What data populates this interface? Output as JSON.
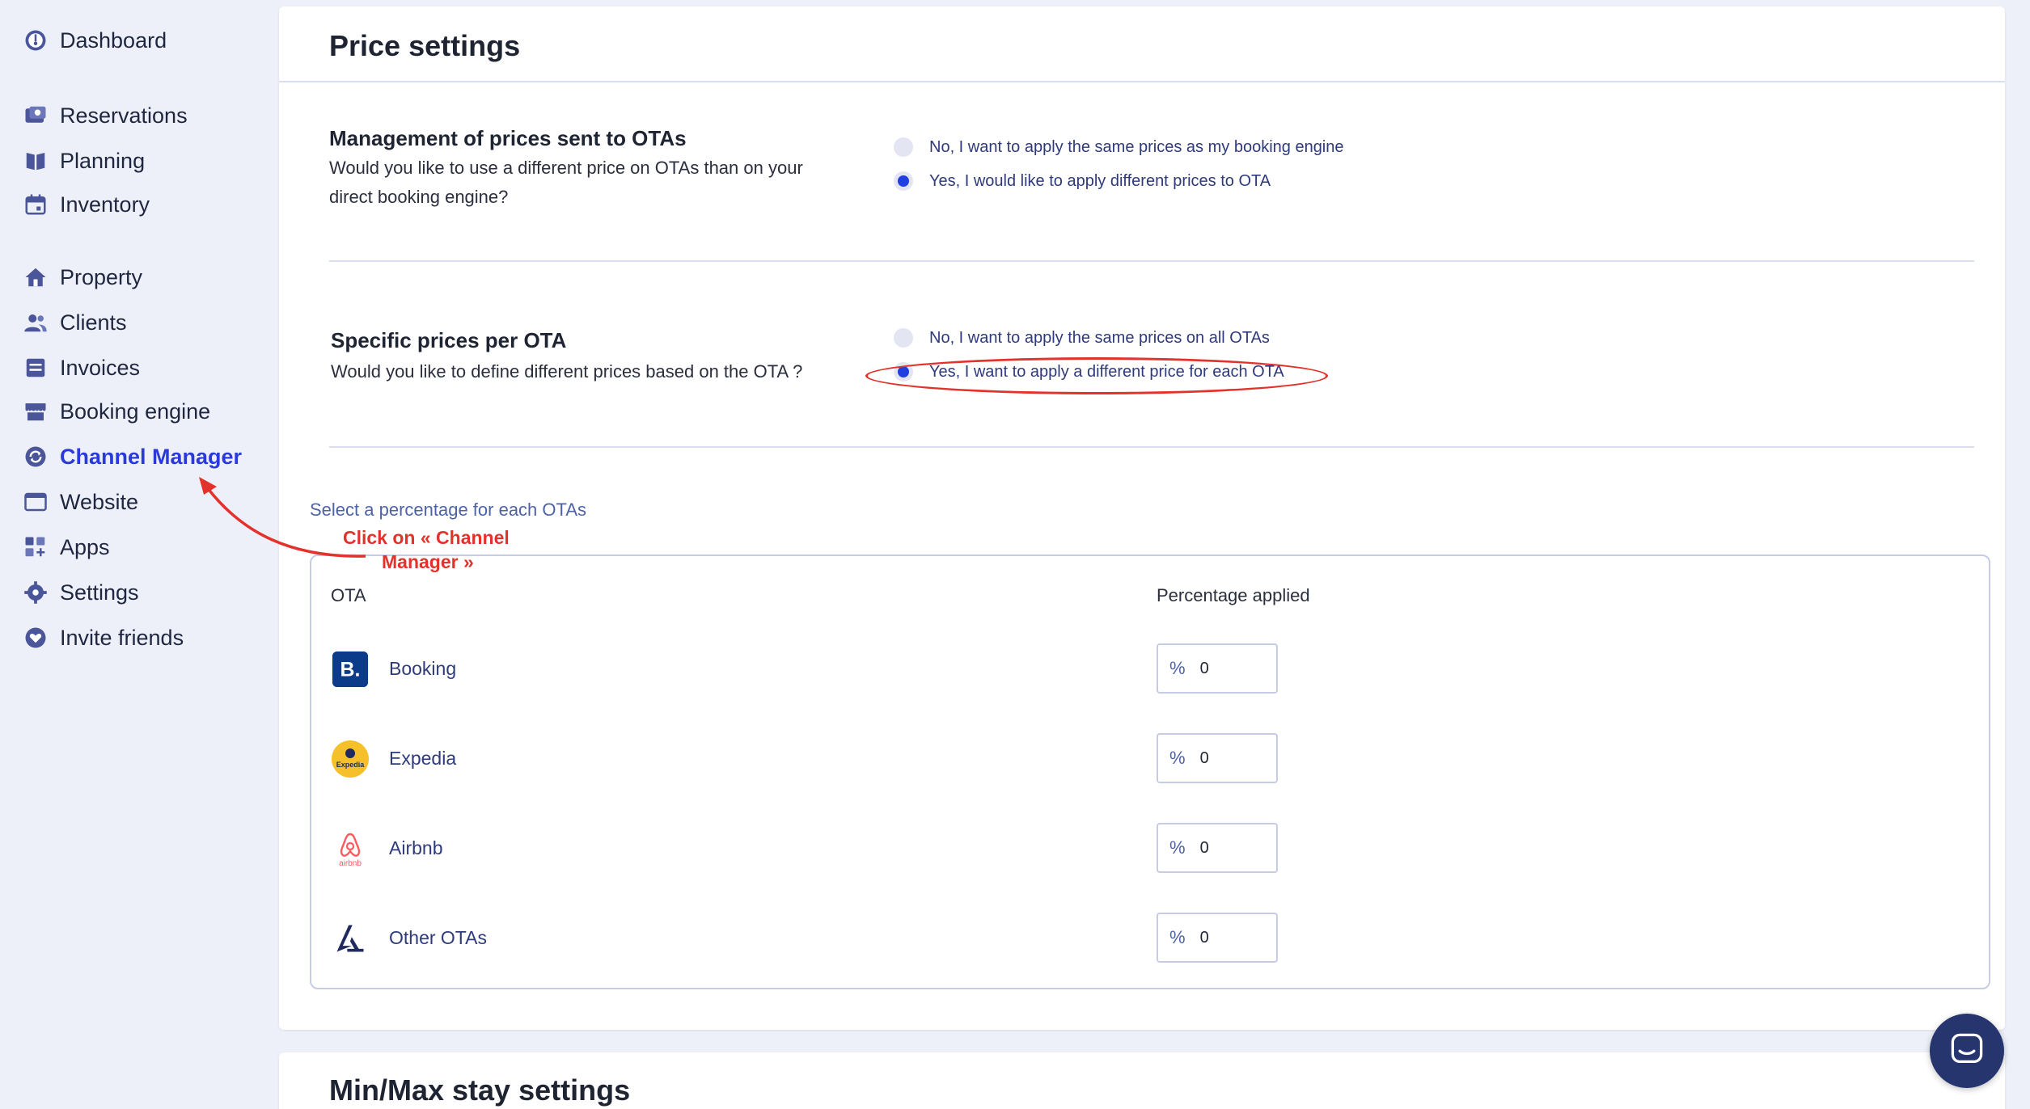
{
  "sidebar": {
    "items": [
      {
        "label": "Dashboard",
        "icon": "dashboard-icon"
      },
      {
        "label": "Reservations",
        "icon": "reservations-icon"
      },
      {
        "label": "Planning",
        "icon": "planning-icon"
      },
      {
        "label": "Inventory",
        "icon": "inventory-icon"
      },
      {
        "label": "Property",
        "icon": "home-icon"
      },
      {
        "label": "Clients",
        "icon": "users-icon"
      },
      {
        "label": "Invoices",
        "icon": "invoice-icon"
      },
      {
        "label": "Booking engine",
        "icon": "store-icon"
      },
      {
        "label": "Channel Manager",
        "icon": "sync-icon",
        "active": true
      },
      {
        "label": "Website",
        "icon": "browser-icon"
      },
      {
        "label": "Apps",
        "icon": "apps-icon"
      },
      {
        "label": "Settings",
        "icon": "gear-icon"
      },
      {
        "label": "Invite friends",
        "icon": "heart-icon"
      }
    ]
  },
  "price_settings": {
    "title": "Price settings",
    "management": {
      "title": "Management of prices sent to OTAs",
      "description": "Would you like to use a different price on OTAs than on your direct booking engine?",
      "options": [
        {
          "label": "No, I want to apply the same prices as my booking engine",
          "checked": false
        },
        {
          "label": "Yes, I would like to apply different prices to OTA",
          "checked": true
        }
      ]
    },
    "specific": {
      "title": "Specific prices per OTA",
      "description": "Would you like to define different prices based on the OTA ?",
      "options": [
        {
          "label": "No, I want to apply the same prices on all OTAs",
          "checked": false
        },
        {
          "label": "Yes, I want to apply a different price for each OTA",
          "checked": true
        }
      ]
    },
    "percentage_section": {
      "label": "Select a percentage for each OTAs",
      "col_ota": "OTA",
      "col_pct": "Percentage applied",
      "pct_symbol": "%",
      "rows": [
        {
          "name": "Booking",
          "value": "0",
          "logo_text": "B."
        },
        {
          "name": "Expedia",
          "value": "0",
          "logo_text": "Expedia"
        },
        {
          "name": "Airbnb",
          "value": "0",
          "logo_text": "airbnb"
        },
        {
          "name": "Other OTAs",
          "value": "0"
        }
      ]
    }
  },
  "annotation": {
    "line1": "Click on « Channel",
    "line2": "Manager »",
    "color": "#e2322b"
  },
  "minmax": {
    "title": "Min/Max stay settings"
  },
  "colors": {
    "accent": "#2a3ad9",
    "radio_checked": "#1f3fe0",
    "chat": "#26356e"
  }
}
